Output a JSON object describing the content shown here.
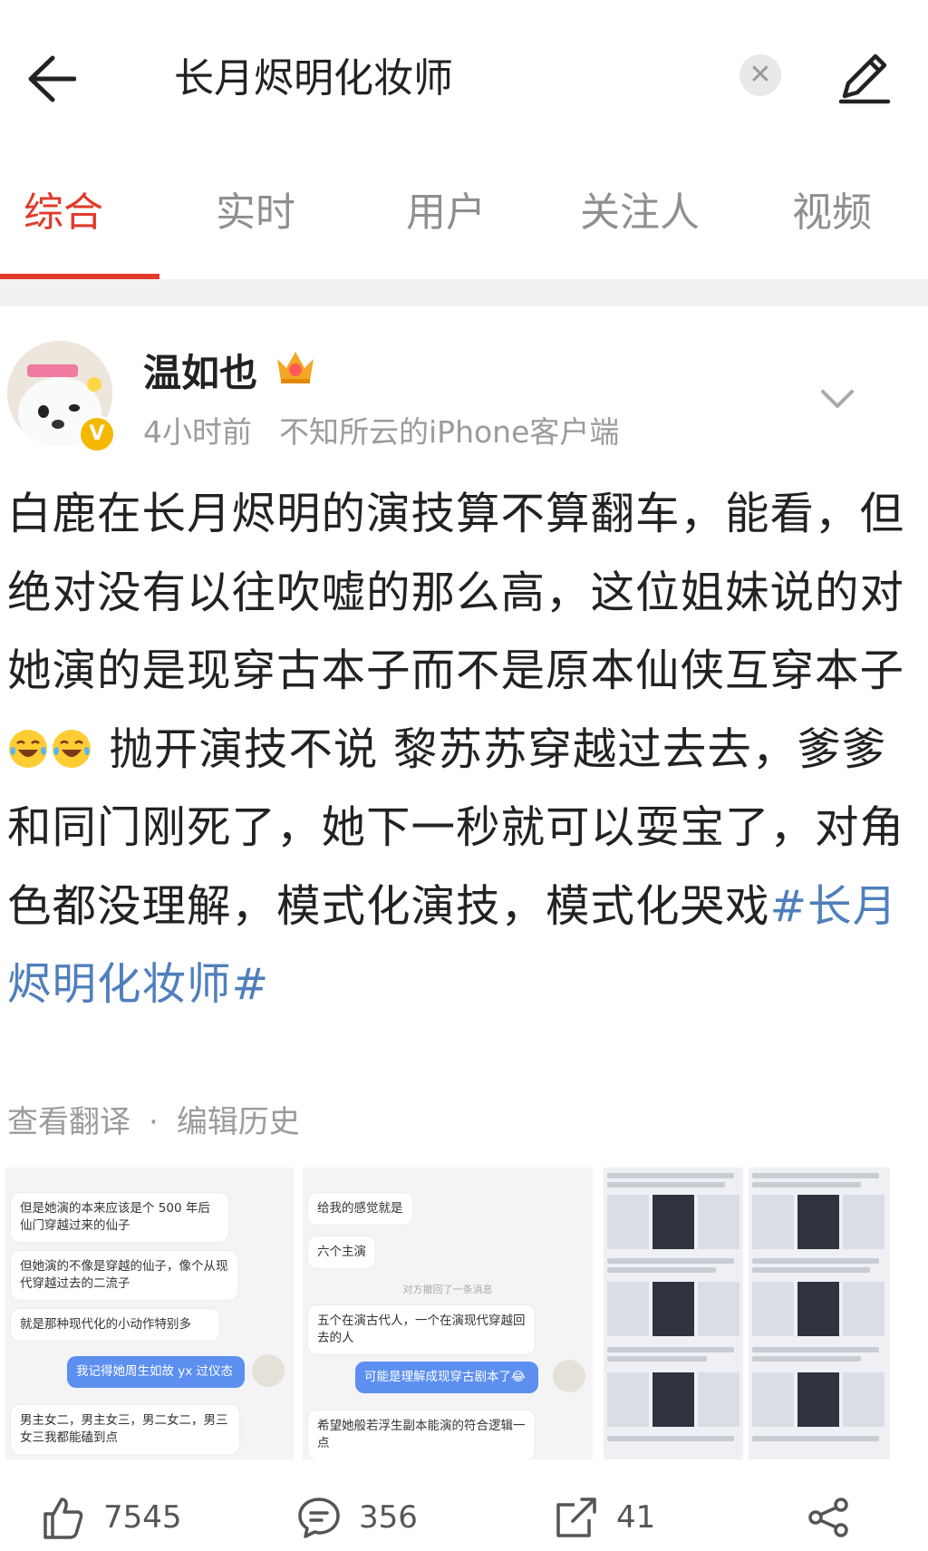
{
  "search": {
    "query": "长月烬明化妆师"
  },
  "tabs": [
    {
      "label": "综合",
      "active": true
    },
    {
      "label": "实时"
    },
    {
      "label": "用户"
    },
    {
      "label": "关注人"
    },
    {
      "label": "视频"
    }
  ],
  "post": {
    "author": "温如也",
    "time": "4小时前",
    "source": "不知所云的iPhone客户端",
    "text_part1": "白鹿在长月烬明的演技算不算翻车，能看，但绝对没有以往吹嘘的那么高，这位姐妹说的对她演的是现穿古本子而不是原本仙侠互穿本子",
    "text_part2": " 抛开演技不说 黎苏苏穿越过去去，爹爹和同门刚死了，她下一秒就可以耍宝了，对角色都没理解，模式化演技，模式化哭戏",
    "hashtag": "#长月烬明化妆师#",
    "translate": "查看翻译",
    "separator": "·",
    "edit_history": "编辑历史"
  },
  "thumb1": {
    "m1": "但是她演的本来应该是个 500 年后仙门穿越过来的仙子",
    "m2": "但她演的不像是穿越的仙子，像个从现代穿越过去的二流子",
    "m3": "就是那种现代化的小动作特别多",
    "m4": "我记得她周生如故 yx 过仪态",
    "m5": "男主女二，男主女三，男二女二，男三女三我都能磕到点"
  },
  "thumb2": {
    "m1": "给我的感觉就是",
    "m2": "六个主演",
    "sys": "对方撤回了一条消息",
    "m3": "五个在演古代人，一个在演现代穿越回去的人",
    "m4": "可能是理解成现穿古剧本了😂",
    "m5": "希望她般若浮生副本能演的符合逻辑一点"
  },
  "actions": {
    "likes": "7545",
    "comments": "356",
    "reposts": "41"
  },
  "icons": [
    "back-icon",
    "clear-icon",
    "edit-icon",
    "crown-icon",
    "verified-icon",
    "chevron-down-icon",
    "like-icon",
    "comment-icon",
    "repost-icon",
    "share-icon"
  ],
  "colors": {
    "accent": "#e23a2a",
    "hashtag": "#4f7fbd",
    "muted": "#9b9b9b",
    "vip": "#f5b800"
  }
}
